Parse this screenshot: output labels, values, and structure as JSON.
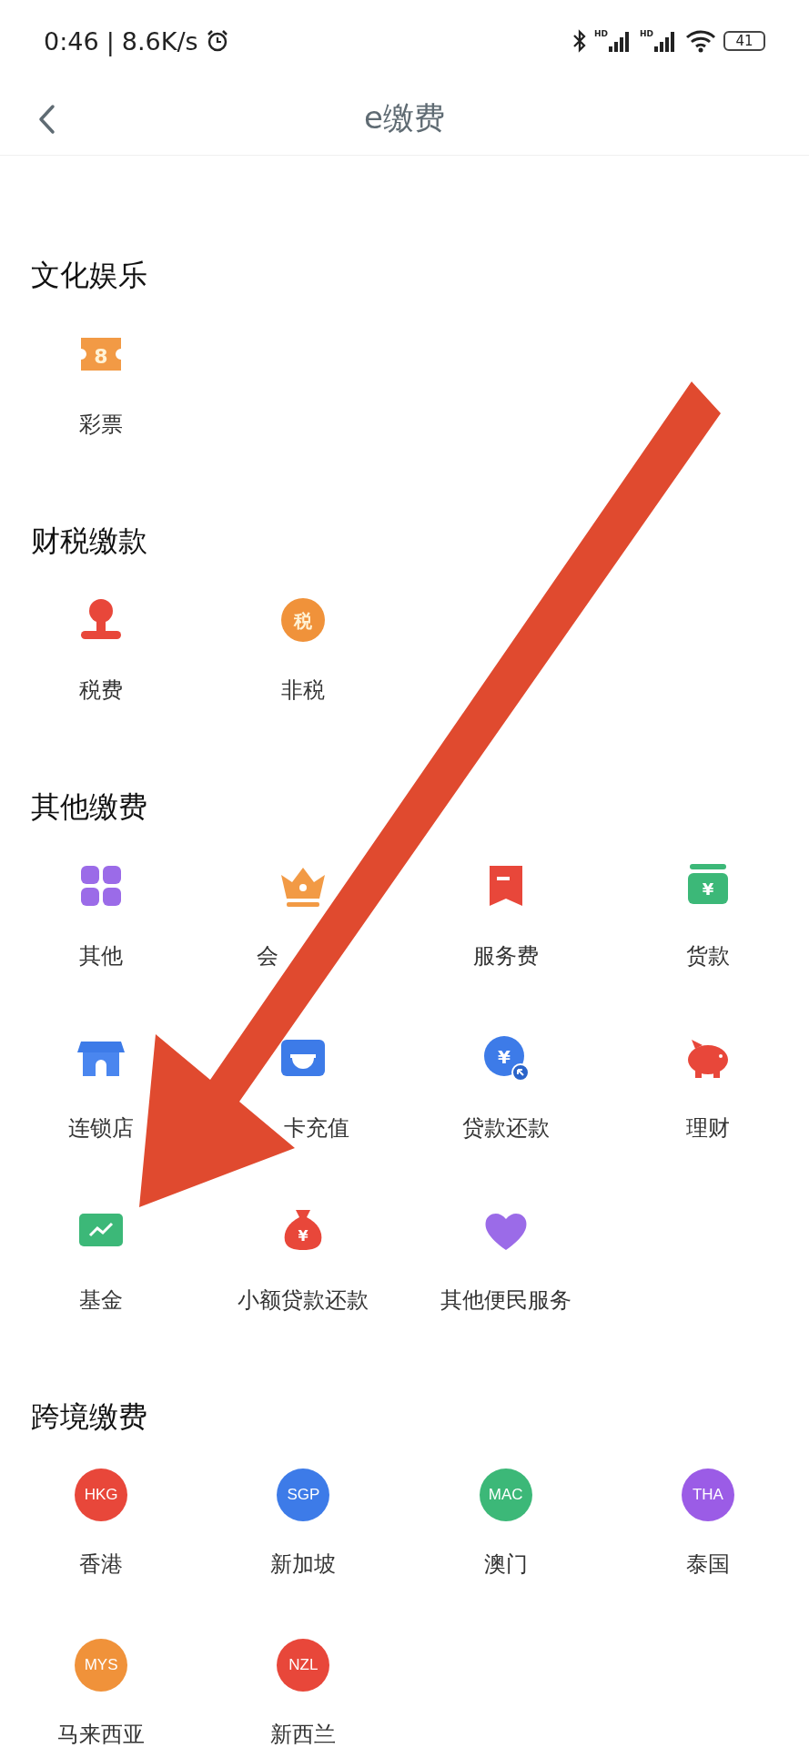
{
  "status_bar": {
    "time": "0:46",
    "separator": "|",
    "speed": "8.6K/s",
    "network_labels": [
      "HD",
      "HD"
    ],
    "battery": "41"
  },
  "header": {
    "title": "e缴费"
  },
  "sections": [
    {
      "title": "文化娱乐",
      "items": [
        {
          "kind": "icon",
          "label": "彩票",
          "badge": "8"
        }
      ]
    },
    {
      "title": "财税缴款",
      "items": [
        {
          "kind": "icon",
          "label": "税费"
        },
        {
          "kind": "icon",
          "label": "非税",
          "badge": "税"
        }
      ]
    },
    {
      "title": "其他缴费",
      "items": [
        {
          "kind": "icon",
          "label": "其他"
        },
        {
          "kind": "icon-label-start-visible",
          "label": "会"
        },
        {
          "kind": "icon",
          "label": "服务费"
        },
        {
          "kind": "icon",
          "label": "货款",
          "badge": "¥"
        },
        {
          "kind": "icon",
          "label": "连锁店"
        },
        {
          "kind": "icon-label-end-visible",
          "label": "卡充值"
        },
        {
          "kind": "icon",
          "label": "贷款还款",
          "badge": "¥"
        },
        {
          "kind": "icon",
          "label": "理财"
        },
        {
          "kind": "icon",
          "label": "基金"
        },
        {
          "kind": "icon",
          "label": "小额贷款还款",
          "badge": "¥"
        },
        {
          "kind": "icon",
          "label": "其他便民服务"
        }
      ]
    },
    {
      "title": "跨境缴费",
      "items": [
        {
          "kind": "globe",
          "label": "香港",
          "badge": "HKG",
          "color": "#e8473a"
        },
        {
          "kind": "globe",
          "label": "新加坡",
          "badge": "SGP",
          "color": "#3d7be8"
        },
        {
          "kind": "globe",
          "label": "澳门",
          "badge": "MAC",
          "color": "#3cb878"
        },
        {
          "kind": "globe",
          "label": "泰国",
          "badge": "THA",
          "color": "#9b5ce6"
        },
        {
          "kind": "globe",
          "label": "马来西亚",
          "badge": "MYS",
          "color": "#f0923a"
        },
        {
          "kind": "globe",
          "label": "新西兰",
          "badge": "NZL",
          "color": "#e8473a"
        }
      ]
    }
  ],
  "overlay": {
    "kind": "arrow"
  }
}
